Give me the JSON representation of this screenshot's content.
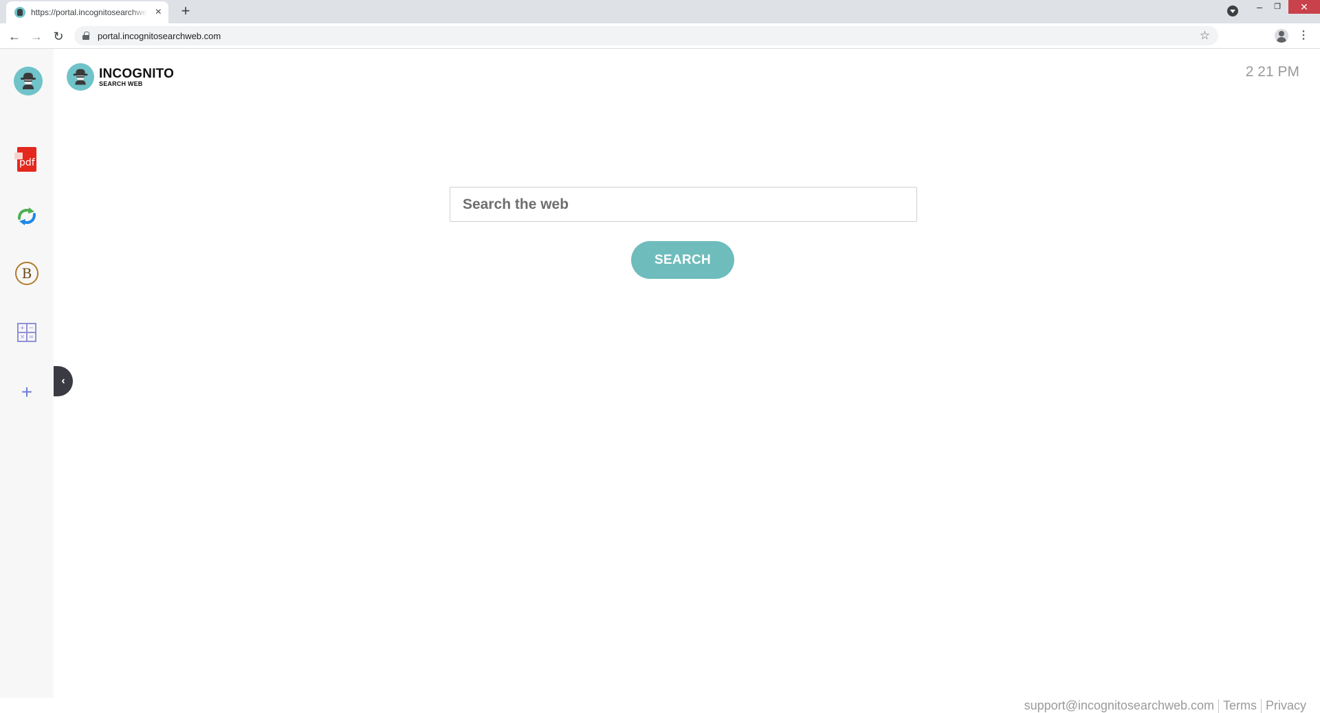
{
  "browser": {
    "tab_title": "https://portal.incognitosearchweb.com",
    "tab_close": "×",
    "new_tab": "+",
    "url": "portal.incognitosearchweb.com",
    "window_controls": {
      "minimize": "–",
      "maximize": "❐",
      "close": "✕"
    },
    "nav": {
      "back": "←",
      "forward": "→",
      "reload": "↻"
    },
    "star": "☆",
    "menu": "⋮"
  },
  "sidebar": {
    "items": [
      {
        "name": "avatar",
        "icon": "spy-icon"
      },
      {
        "name": "pdf",
        "icon": "pdf-icon",
        "label": "pdf"
      },
      {
        "name": "pdf-converter",
        "icon": "convert-arrows-icon"
      },
      {
        "name": "bitcoin",
        "icon": "bitcoin-icon",
        "label": "B"
      },
      {
        "name": "calculator",
        "icon": "calculator-icon",
        "symbols": [
          "+",
          "−",
          "×",
          "="
        ]
      },
      {
        "name": "add",
        "icon": "plus-icon",
        "label": "+"
      }
    ],
    "collapse_label": "‹"
  },
  "header": {
    "logo_main": "INCOGNITO",
    "logo_sub": "SEARCH WEB",
    "time": "2 21 PM"
  },
  "search": {
    "placeholder": "Search the web",
    "button_label": "SEARCH"
  },
  "footer": {
    "email": "support@incognitosearchweb.com",
    "terms": "Terms",
    "privacy": "Privacy"
  },
  "colors": {
    "accent": "#6fbcbc",
    "logo_circle": "#6fc3c9",
    "close_button": "#c9414b"
  }
}
